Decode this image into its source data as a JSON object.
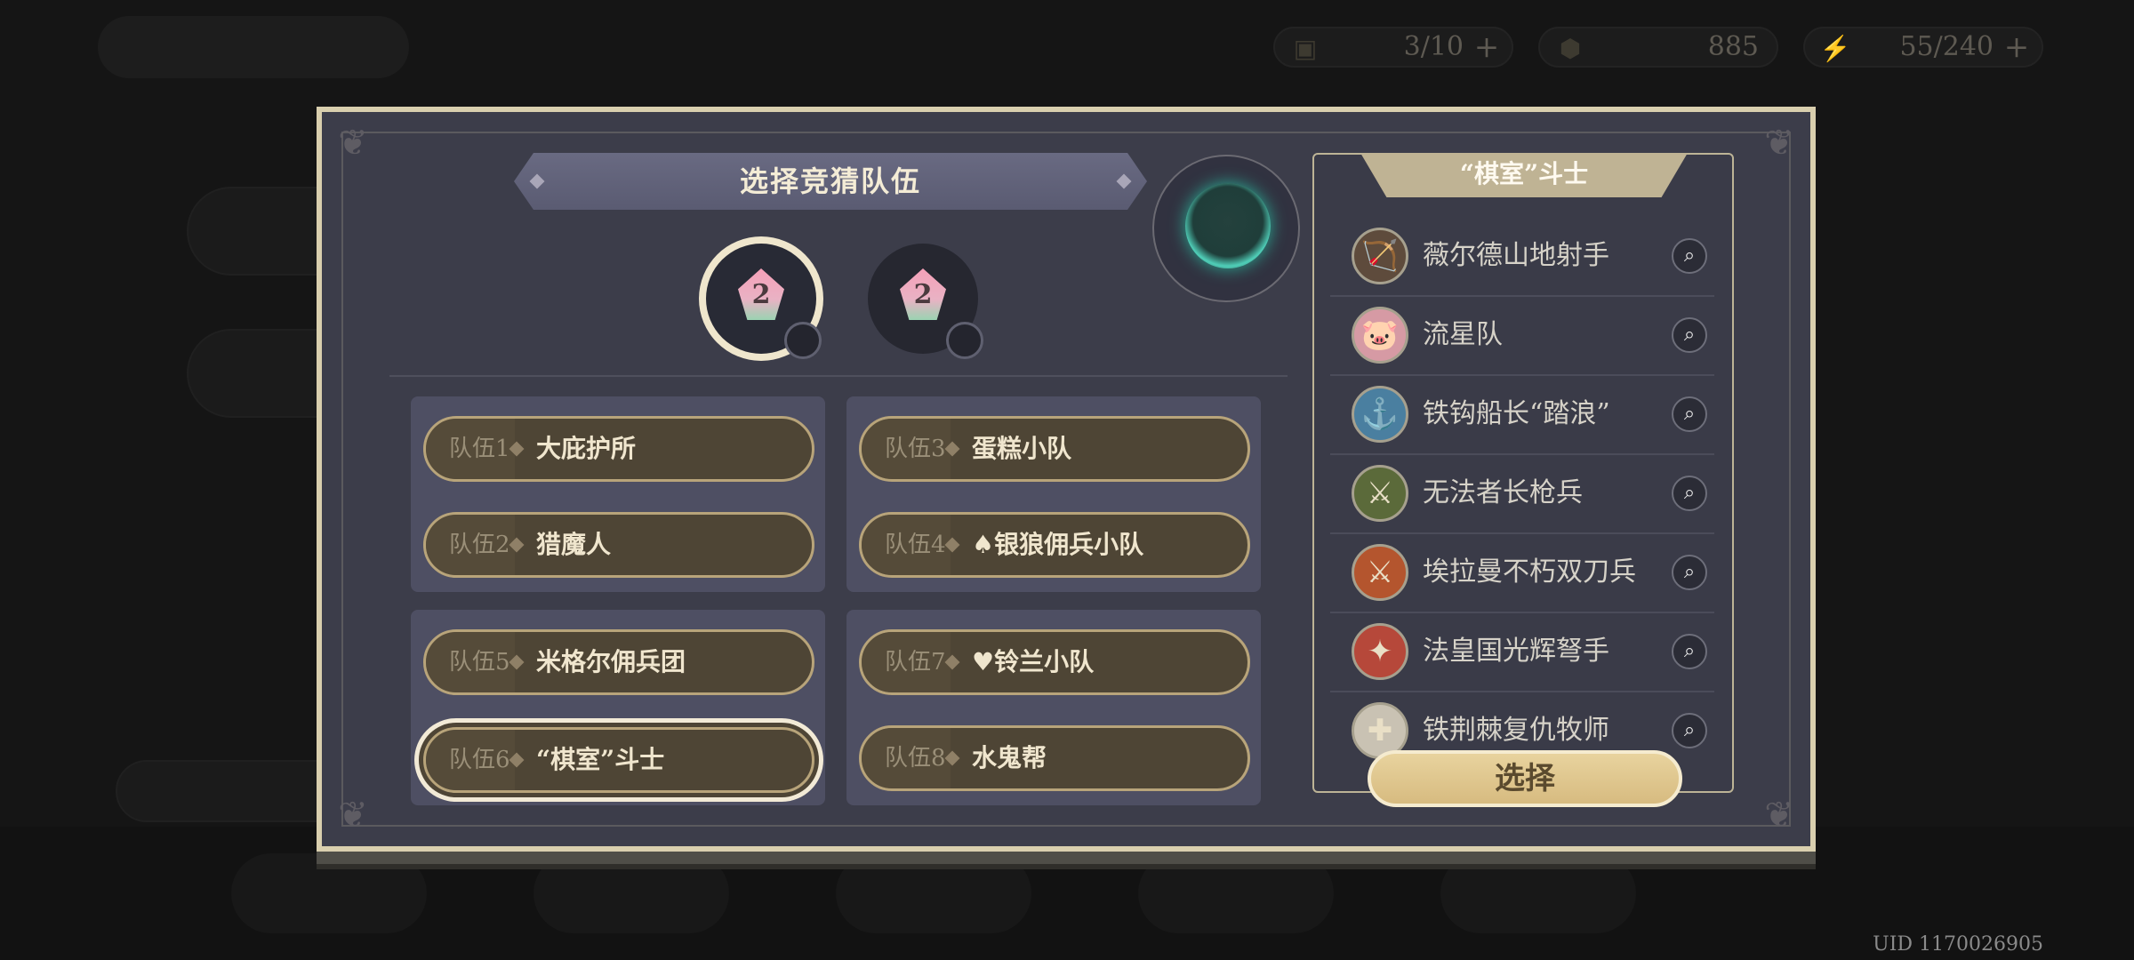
{
  "colors": {
    "dialog_bg": "#3c3d4a",
    "frame": "#d9cfae",
    "team_pill": "#4e4535",
    "button_gold": "#d7bb80",
    "orb_teal": "#4fcdb7"
  },
  "resources": [
    {
      "icon": "card-icon",
      "value": "3/10"
    },
    {
      "icon": "coin-icon",
      "value": "885"
    },
    {
      "icon": "energy-icon",
      "value": "55/240"
    }
  ],
  "dialog": {
    "title": "选择竞猜队伍",
    "badges": [
      {
        "value": "2",
        "selected": true
      },
      {
        "value": "2",
        "selected": false
      }
    ],
    "teams": [
      {
        "num": "队伍1",
        "name": "大庇护所"
      },
      {
        "num": "队伍2",
        "name": "猎魔人"
      },
      {
        "num": "队伍3",
        "name": "蛋糕小队"
      },
      {
        "num": "队伍4",
        "name": "♠银狼佣兵小队"
      },
      {
        "num": "队伍5",
        "name": "米格尔佣兵团"
      },
      {
        "num": "队伍6",
        "name": "“棋室”斗士",
        "selected": true
      },
      {
        "num": "队伍7",
        "name": "♥铃兰小队"
      },
      {
        "num": "队伍8",
        "name": "水鬼帮"
      }
    ]
  },
  "roster": {
    "title": "“棋室”斗士",
    "members": [
      {
        "name": "薇尔德山地射手",
        "avatar_icon": "archer-avatar-icon"
      },
      {
        "name": "流星队",
        "avatar_icon": "pig-avatar-icon"
      },
      {
        "name": "铁钩船长“踏浪”",
        "avatar_icon": "captain-avatar-icon"
      },
      {
        "name": "无法者长枪兵",
        "avatar_icon": "spearman-avatar-icon"
      },
      {
        "name": "埃拉曼不朽双刀兵",
        "avatar_icon": "blademaster-avatar-icon"
      },
      {
        "name": "法皇国光辉弩手",
        "avatar_icon": "crossbow-avatar-icon"
      },
      {
        "name": "铁荆棘复仇牧师",
        "avatar_icon": "priest-avatar-icon"
      }
    ],
    "button_label": "选择"
  },
  "uid": "UID 1170026905"
}
